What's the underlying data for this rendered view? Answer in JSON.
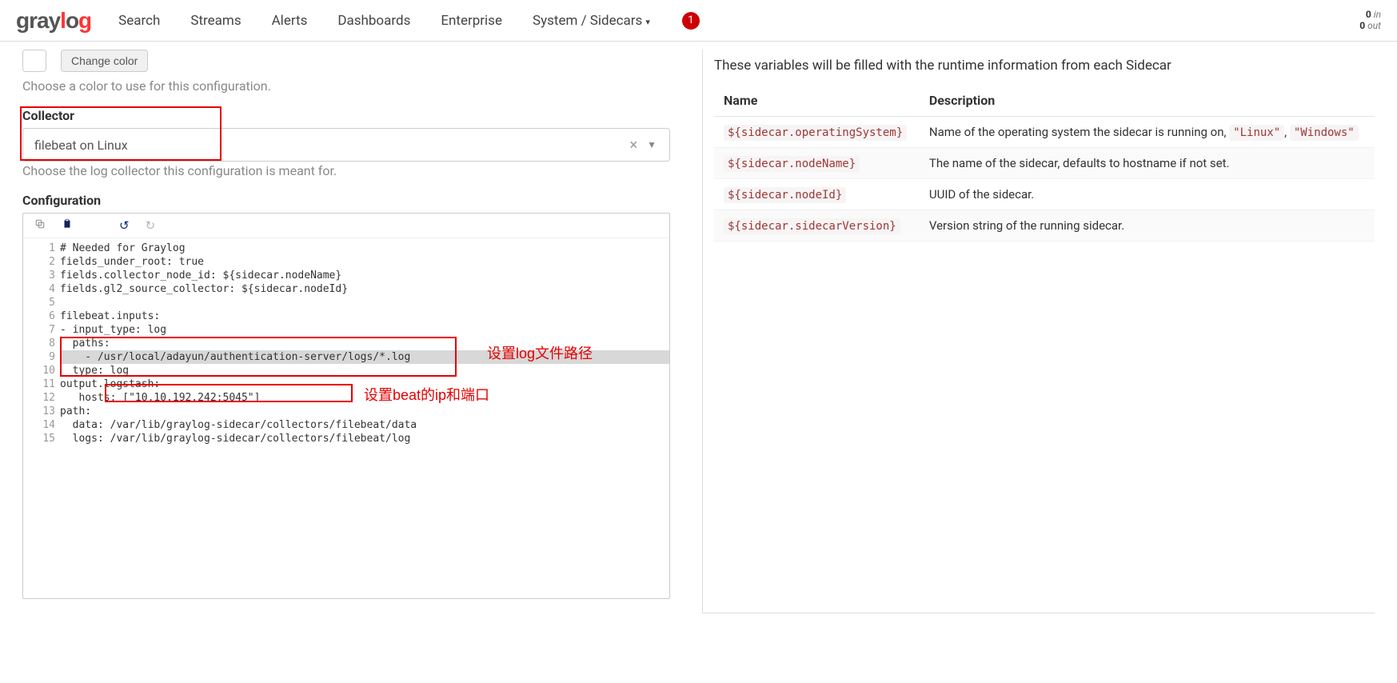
{
  "logo": {
    "part1": "gray",
    "part2": "l",
    "part3": "o",
    "part4": "g"
  },
  "nav": {
    "search": "Search",
    "streams": "Streams",
    "alerts": "Alerts",
    "dashboards": "Dashboards",
    "enterprise": "Enterprise",
    "system": "System / Sidecars"
  },
  "notif_count": "1",
  "throughput": {
    "in_val": "0",
    "in_lbl": "in",
    "out_val": "0",
    "out_lbl": "out"
  },
  "color_section": {
    "btn": "Change color",
    "help": "Choose a color to use for this configuration."
  },
  "collector_section": {
    "title": "Collector",
    "value": "filebeat on Linux",
    "help": "Choose the log collector this configuration is meant for."
  },
  "config_section": {
    "title": "Configuration",
    "lines": [
      "# Needed for Graylog",
      "fields_under_root: true",
      "fields.collector_node_id: ${sidecar.nodeName}",
      "fields.gl2_source_collector: ${sidecar.nodeId}",
      "",
      "filebeat.inputs:",
      "- input_type: log",
      "  paths:",
      "    - /usr/local/adayun/authentication-server/logs/*.log",
      "  type: log",
      "output.logstash:",
      "   hosts: [\"10.10.192.242:5045\"]",
      "path:",
      "  data: /var/lib/graylog-sidecar/collectors/filebeat/data",
      "  logs: /var/lib/graylog-sidecar/collectors/filebeat/log"
    ],
    "ann_paths": "设置log文件路径",
    "ann_hosts": "设置beat的ip和端口"
  },
  "variables": {
    "intro": "These variables will be filled with the runtime information from each Sidecar",
    "col_name": "Name",
    "col_desc": "Description",
    "rows": [
      {
        "name": "${sidecar.operatingSystem}",
        "desc_pre": "Name of the operating system the sidecar is running on, ",
        "extra1": "\"Linux\"",
        "sep": ", ",
        "extra2": "\"Windows\""
      },
      {
        "name": "${sidecar.nodeName}",
        "desc": "The name of the sidecar, defaults to hostname if not set."
      },
      {
        "name": "${sidecar.nodeId}",
        "desc": "UUID of the sidecar."
      },
      {
        "name": "${sidecar.sidecarVersion}",
        "desc": "Version string of the running sidecar."
      }
    ]
  }
}
